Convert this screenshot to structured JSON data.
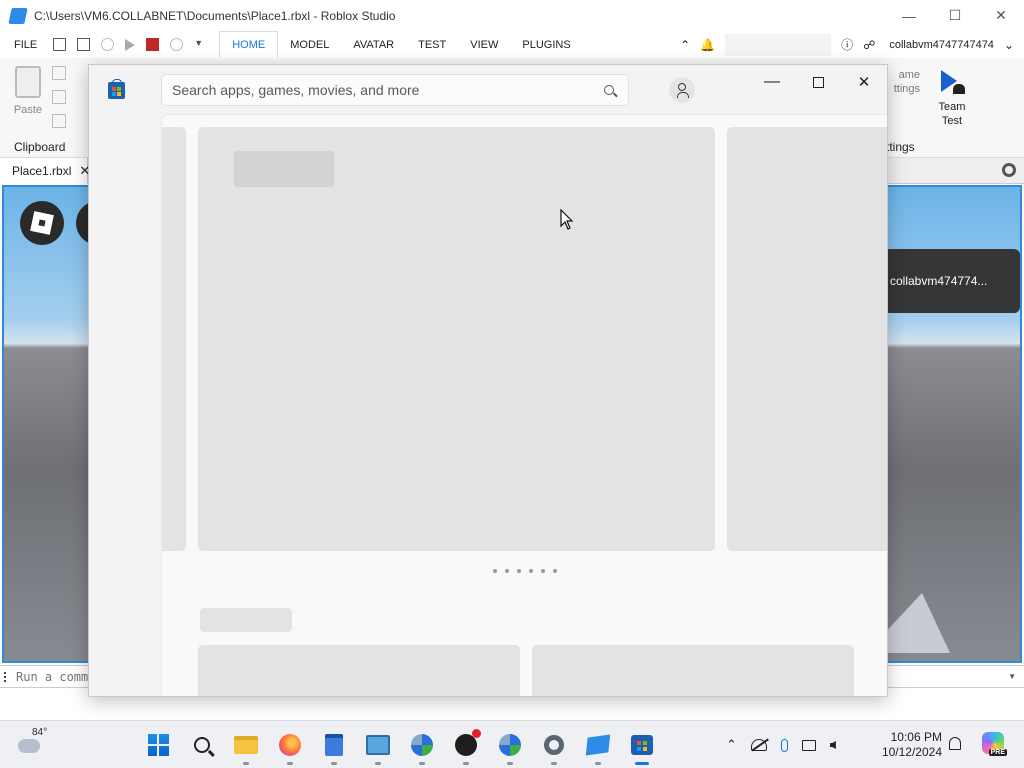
{
  "studio": {
    "title": "C:\\Users\\VM6.COLLABNET\\Documents\\Place1.rbxl - Roblox Studio",
    "menu": {
      "file": "FILE"
    },
    "tabs": [
      "HOME",
      "MODEL",
      "AVATAR",
      "TEST",
      "VIEW",
      "PLUGINS"
    ],
    "active_tab": "HOME",
    "username": "collabvm4747747474",
    "ribbon": {
      "paste": "Paste",
      "clipboard_group": "Clipboard",
      "game_settings_partial": "ame\nttings",
      "settings_group_partial": "ttings",
      "team_test": "Team\nTest"
    },
    "doc_tab": "Place1.rbxl",
    "viewport": {
      "player_name": "collabvm474774..."
    },
    "command_bar": {
      "placeholder": "Run a command"
    }
  },
  "store": {
    "search_placeholder": "Search apps, games, movies, and more",
    "carousel_dots": 6,
    "accent": "#1e5fb4"
  },
  "taskbar": {
    "weather_temp": "84°",
    "apps": [
      "start",
      "search",
      "file-explorer",
      "firefox",
      "notepad",
      "control-panel",
      "network-app",
      "obs",
      "network-app-2",
      "settings",
      "roblox-studio",
      "microsoft-store"
    ],
    "active_app": "microsoft-store",
    "time": "10:06 PM",
    "date": "10/12/2024",
    "copilot_badge": "PRE"
  }
}
